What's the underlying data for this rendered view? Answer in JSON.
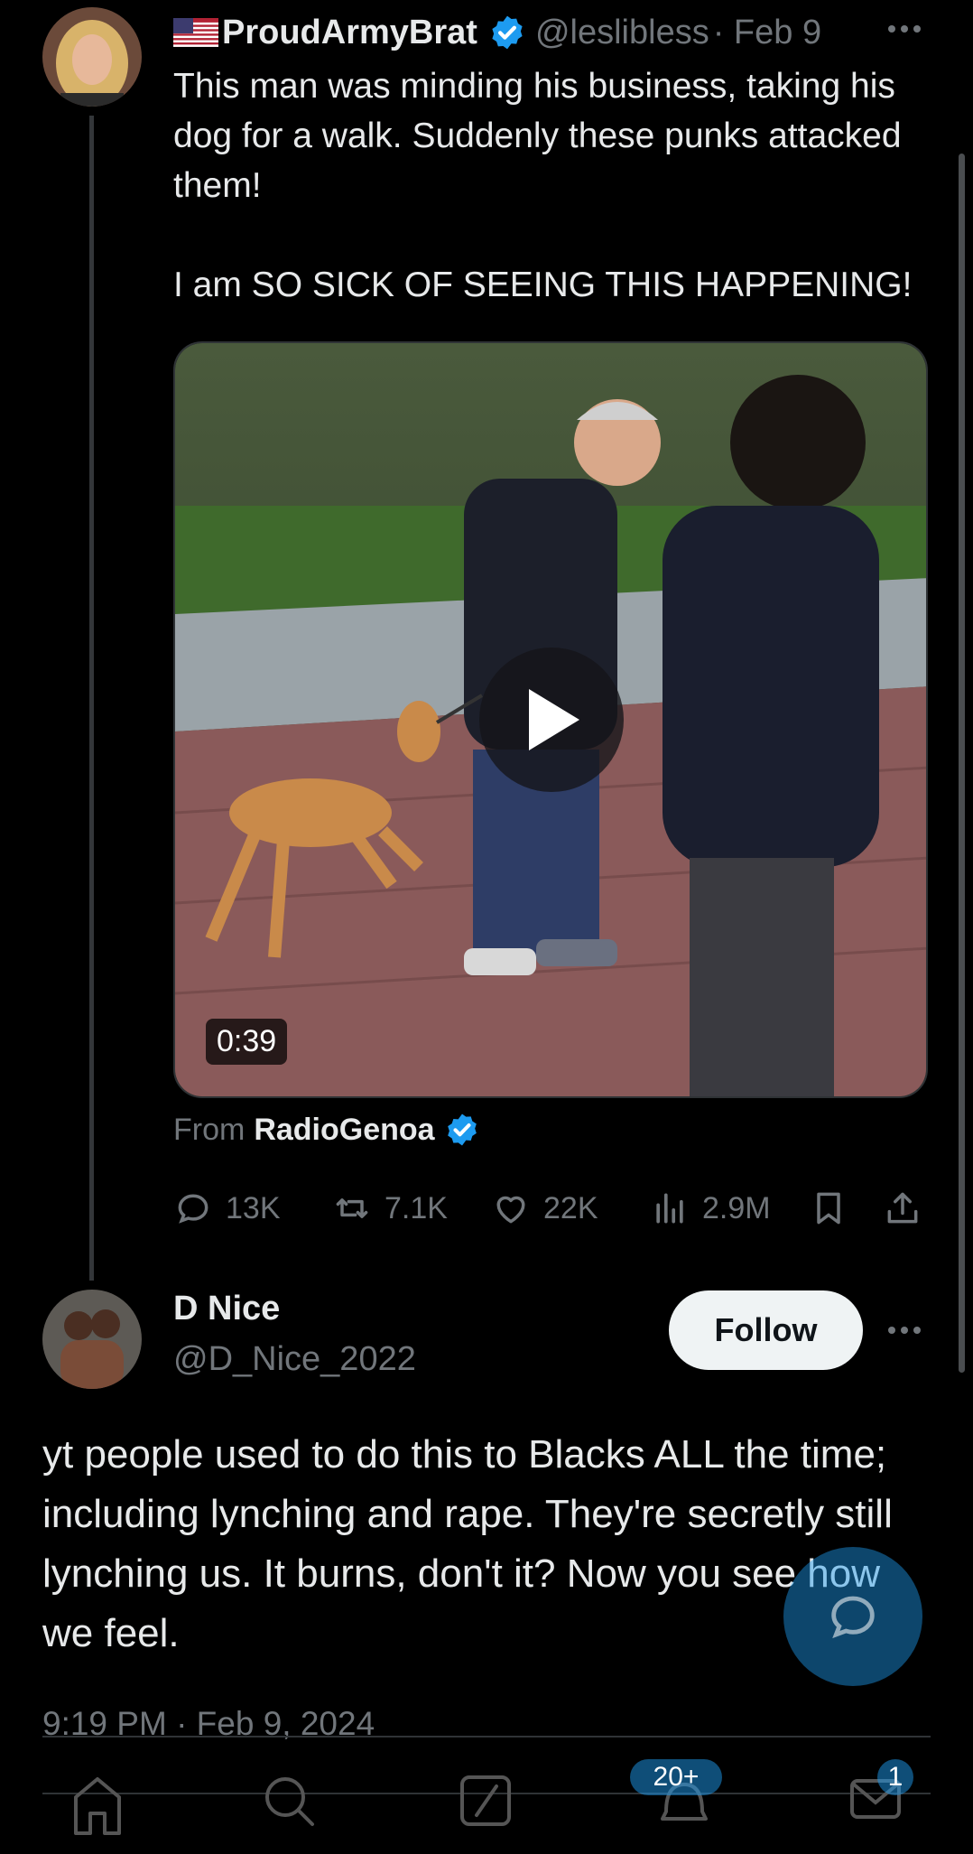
{
  "tweet": {
    "display_name": "ProudArmyBrat",
    "handle": "@leslibless",
    "date_sep": "· Feb 9",
    "text": "This man was minding his business, taking his dog for a walk. Suddenly these punks attacked them!\n\nI am SO SICK OF SEEING THIS HAPPENING!",
    "video_duration": "0:39",
    "from_label": "From",
    "from_source": "RadioGenoa",
    "stats": {
      "replies": "13K",
      "retweets": "7.1K",
      "likes": "22K",
      "views": "2.9M"
    }
  },
  "reply": {
    "display_name": "D Nice",
    "handle": "@D_Nice_2022",
    "follow_label": "Follow",
    "text": "yt people used to do this to Blacks ALL the time; including lynching and rape.  They're secretly still lynching us.  It burns, don't it? Now you see how we feel.",
    "timestamp": "9:19 PM · Feb 9, 2024"
  },
  "nav": {
    "notifications_badge": "20+",
    "messages_badge": "1"
  },
  "colors": {
    "background": "#000000",
    "text": "#e7e9ea",
    "secondary": "#71767b",
    "accent": "#1d9bf0"
  },
  "icons": [
    "us-flag-icon",
    "verified-icon",
    "more-icon",
    "play-icon",
    "reply-icon",
    "retweet-icon",
    "like-icon",
    "views-icon",
    "bookmark-icon",
    "share-icon",
    "compose-icon",
    "home-icon",
    "search-icon",
    "grok-icon",
    "notifications-icon",
    "messages-icon"
  ]
}
